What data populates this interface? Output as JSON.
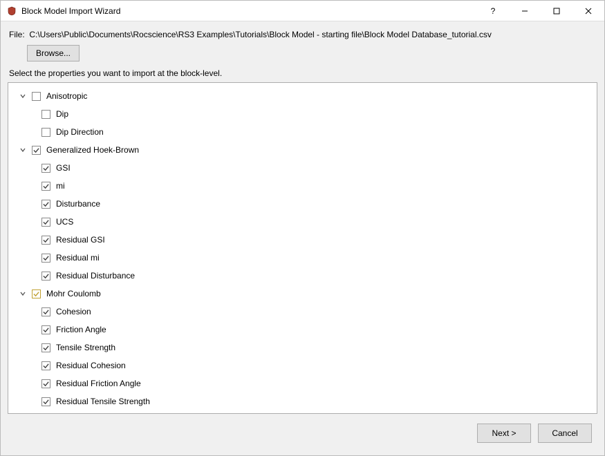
{
  "titlebar": {
    "title": "Block Model Import Wizard",
    "help_symbol": "?"
  },
  "file_label": "File:",
  "file_path": "C:\\Users\\Public\\Documents\\Rocscience\\RS3 Examples\\Tutorials\\Block Model - starting file\\Block Model Database_tutorial.csv",
  "browse_label": "Browse...",
  "instruction": "Select the properties you want to import at the block-level.",
  "groups": [
    {
      "label": "Anisotropic",
      "checked": false,
      "gold": false,
      "children": [
        {
          "label": "Dip",
          "checked": false
        },
        {
          "label": "Dip Direction",
          "checked": false
        }
      ]
    },
    {
      "label": "Generalized Hoek-Brown",
      "checked": true,
      "gold": false,
      "children": [
        {
          "label": "GSI",
          "checked": true
        },
        {
          "label": "mi",
          "checked": true
        },
        {
          "label": "Disturbance",
          "checked": true
        },
        {
          "label": "UCS",
          "checked": true
        },
        {
          "label": "Residual GSI",
          "checked": true
        },
        {
          "label": "Residual mi",
          "checked": true
        },
        {
          "label": "Residual Disturbance",
          "checked": true
        }
      ]
    },
    {
      "label": "Mohr Coulomb",
      "checked": true,
      "gold": true,
      "children": [
        {
          "label": "Cohesion",
          "checked": true
        },
        {
          "label": "Friction Angle",
          "checked": true
        },
        {
          "label": "Tensile Strength",
          "checked": true
        },
        {
          "label": "Residual Cohesion",
          "checked": true
        },
        {
          "label": "Residual Friction Angle",
          "checked": true
        },
        {
          "label": "Residual Tensile Strength",
          "checked": true
        }
      ]
    }
  ],
  "footer": {
    "next_label": "Next >",
    "cancel_label": "Cancel"
  }
}
